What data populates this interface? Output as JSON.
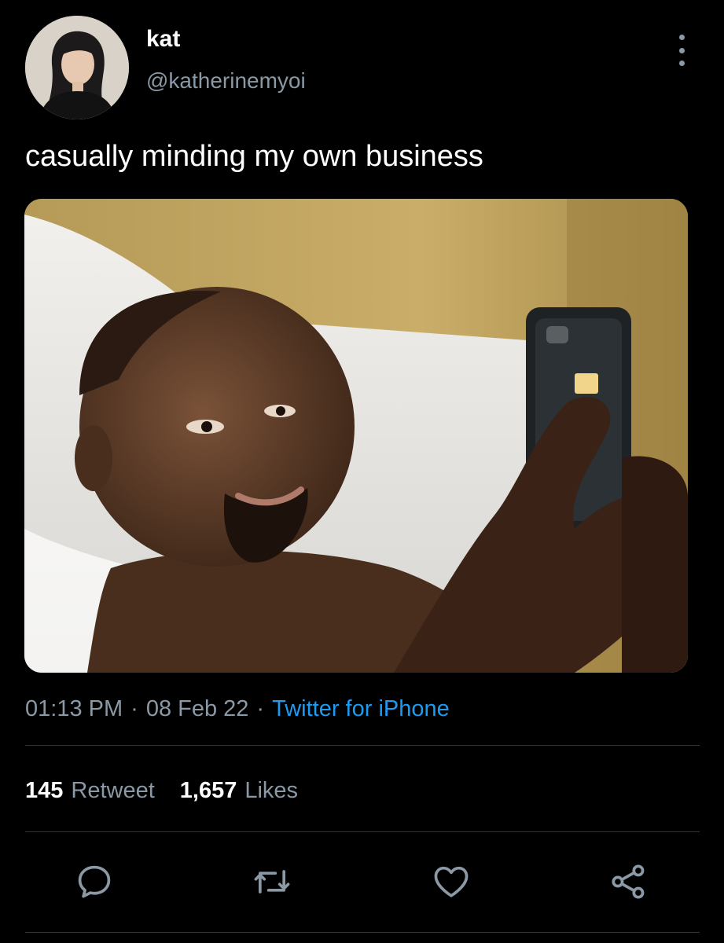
{
  "author": {
    "display_name": "kat",
    "handle": "@katherinemyoi",
    "avatar_icon": "profile-photo"
  },
  "tweet": {
    "text": "casually minding my own business",
    "media_icon": "photo-man-in-bed-looking-at-phone"
  },
  "meta": {
    "time": "01:13 PM",
    "separator": "·",
    "date": "08 Feb 22",
    "source": "Twitter for iPhone"
  },
  "stats": {
    "retweets_count": "145",
    "retweets_label": "Retweet",
    "likes_count": "1,657",
    "likes_label": "Likes"
  },
  "actions": {
    "reply_icon": "reply-icon",
    "retweet_icon": "retweet-icon",
    "like_icon": "heart-icon",
    "share_icon": "share-icon",
    "more_icon": "more-vertical-icon"
  },
  "colors": {
    "background": "#000000",
    "text_primary": "#ffffff",
    "text_secondary": "#8b98a5",
    "accent": "#1d9bf0",
    "divider": "#2f3336"
  }
}
